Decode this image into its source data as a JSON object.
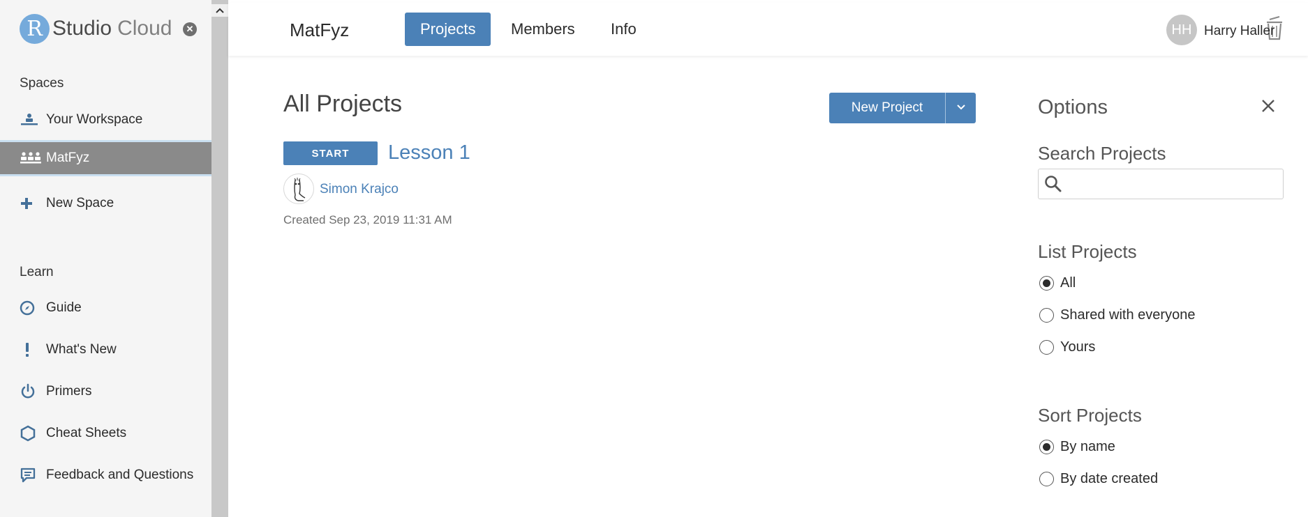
{
  "brand": {
    "letter": "R",
    "studio": "Studio",
    "cloud": "Cloud"
  },
  "sidebar": {
    "spaces_title": "Spaces",
    "spaces": [
      {
        "label": "Your Workspace",
        "icon": "workspace-icon"
      },
      {
        "label": "MatFyz",
        "icon": "group-icon",
        "active": true
      },
      {
        "label": "New Space",
        "icon": "plus-icon"
      }
    ],
    "learn_title": "Learn",
    "learn": [
      {
        "label": "Guide",
        "icon": "compass-icon"
      },
      {
        "label": "What's New",
        "icon": "exclamation-icon"
      },
      {
        "label": "Primers",
        "icon": "power-icon"
      },
      {
        "label": "Cheat Sheets",
        "icon": "hexagon-icon"
      },
      {
        "label": "Feedback and Questions",
        "icon": "chat-icon"
      }
    ]
  },
  "header": {
    "space_name": "MatFyz",
    "tabs": [
      {
        "label": "Projects",
        "active": true
      },
      {
        "label": "Members"
      },
      {
        "label": "Info"
      }
    ],
    "avatar_initials": "HH",
    "user_name": "Harry Haller"
  },
  "main": {
    "title": "All Projects",
    "new_project_label": "New Project",
    "projects": [
      {
        "start_label": "START",
        "name": "Lesson 1",
        "author": "Simon Krajco",
        "created": "Created Sep 23, 2019 11:31 AM"
      }
    ]
  },
  "options": {
    "title": "Options",
    "search_heading": "Search Projects",
    "search_value": "",
    "list_heading": "List Projects",
    "list_options": [
      {
        "label": "All",
        "checked": true
      },
      {
        "label": "Shared with everyone",
        "checked": false
      },
      {
        "label": "Yours",
        "checked": false
      }
    ],
    "sort_heading": "Sort Projects",
    "sort_options": [
      {
        "label": "By name",
        "checked": true
      },
      {
        "label": "By date created",
        "checked": false
      }
    ]
  },
  "colors": {
    "accent": "#4b81b7",
    "brand": "#75aadb",
    "active_nav": "#8a8a8a"
  }
}
